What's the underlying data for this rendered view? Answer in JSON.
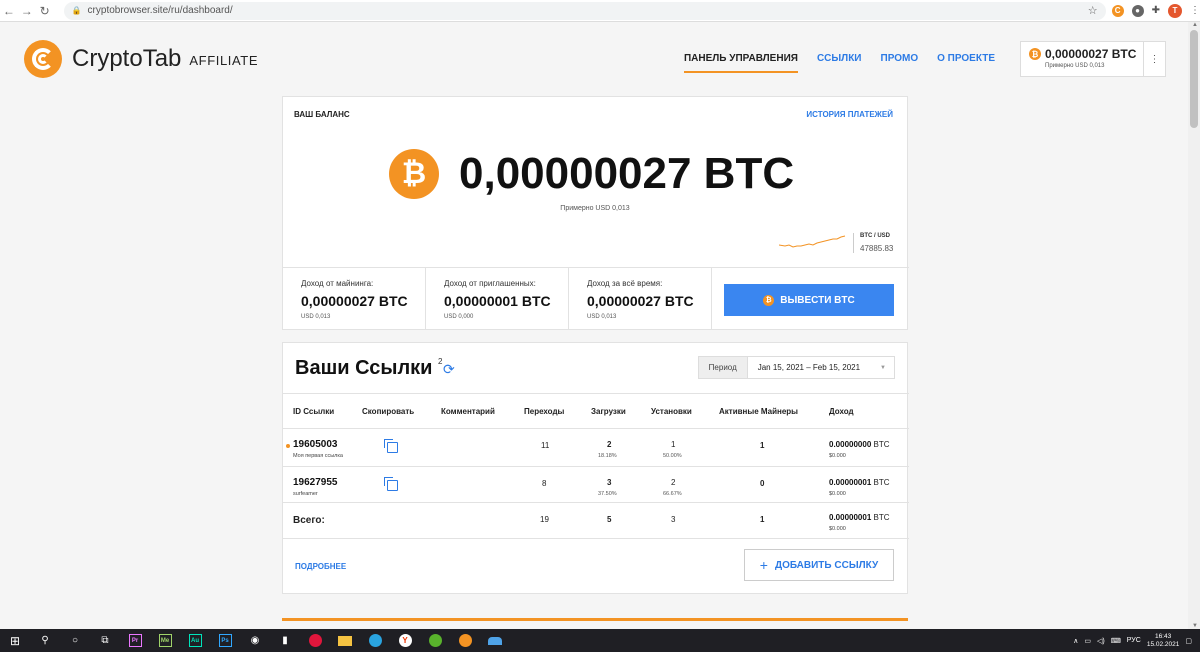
{
  "browser": {
    "url": "cryptobrowser.site/ru/dashboard/",
    "avatar_letter": "T"
  },
  "header": {
    "logo_text": "CryptoTab",
    "logo_sub": "AFFILIATE",
    "nav": [
      "ПАНЕЛЬ УПРАВЛЕНИЯ",
      "ССЫЛКИ",
      "ПРОМО",
      "О ПРОЕКТЕ"
    ],
    "mini_balance": "0,00000027 BTC",
    "mini_approx": "Примерно USD 0,013"
  },
  "balance": {
    "title": "ВАШ БАЛАНС",
    "history_link": "ИСТОРИЯ ПЛАТЕЖЕЙ",
    "amount": "0,00000027 BTC",
    "approx": "Примерно USD 0,013",
    "rate_label": "BTC / USD",
    "rate_value": "47885.83",
    "stats": [
      {
        "label": "Доход от майнинга:",
        "value": "0,00000027 BTC",
        "usd": "USD 0,013"
      },
      {
        "label": "Доход от приглашенных:",
        "value": "0,00000001 BTC",
        "usd": "USD 0,000"
      },
      {
        "label": "Доход за всё время:",
        "value": "0,00000027 BTC",
        "usd": "USD 0,013"
      }
    ],
    "withdraw_label": "ВЫВЕСТИ BTC"
  },
  "links": {
    "title": "Ваши Ссылки",
    "count": "2",
    "period_label": "Период",
    "period_value": "Jan 15, 2021 – Feb 15, 2021",
    "columns": [
      "ID Ссылки",
      "Скопировать",
      "Комментарий",
      "Переходы",
      "Загрузки",
      "Установки",
      "Активные Майнеры",
      "Доход"
    ],
    "rows": [
      {
        "id": "19605003",
        "name": "Моя первая ссылка",
        "clicks": "11",
        "downloads": "2",
        "downloads_pct": "18.18%",
        "installs": "1",
        "installs_pct": "50.00%",
        "miners": "1",
        "income_btc": "0.00000000",
        "income_unit": "BTC",
        "income_usd": "$0.000"
      },
      {
        "id": "19627955",
        "name": "surfeamer",
        "clicks": "8",
        "downloads": "3",
        "downloads_pct": "37.50%",
        "installs": "2",
        "installs_pct": "66.67%",
        "miners": "0",
        "income_btc": "0.00000001",
        "income_unit": "BTC",
        "income_usd": "$0.000"
      }
    ],
    "total": {
      "label": "Всего:",
      "clicks": "19",
      "downloads": "5",
      "installs": "3",
      "miners": "1",
      "income_btc": "0.00000001",
      "income_unit": "BTC",
      "income_usd": "$0.000"
    },
    "more_link": "ПОДРОБНЕЕ",
    "add_button": "ДОБАВИТЬ ССЫЛКУ"
  },
  "taskbar": {
    "lang": "РУС",
    "time": "16:43",
    "date": "15.02.2021"
  },
  "colors": {
    "accent": "#f39323",
    "link": "#2d7be5",
    "button": "#3a86f0"
  }
}
